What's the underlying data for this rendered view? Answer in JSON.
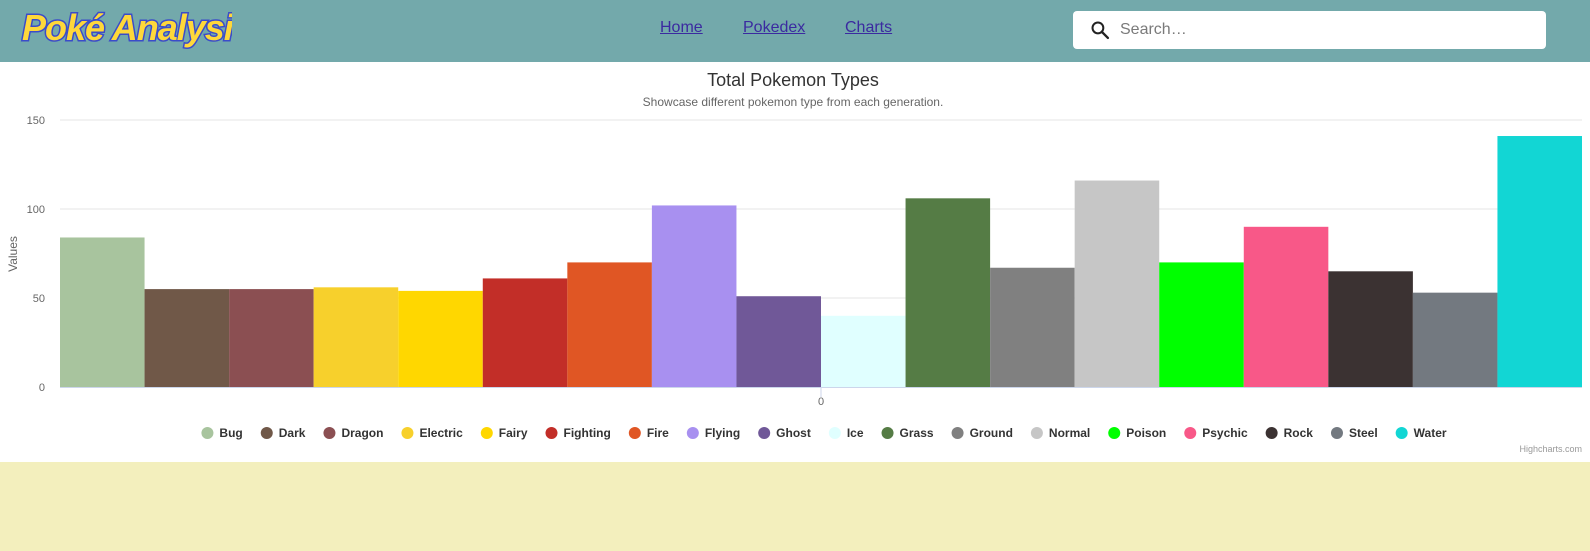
{
  "header": {
    "logo_text": "Poké Analysis",
    "nav": [
      {
        "label": "Home"
      },
      {
        "label": "Pokedex"
      },
      {
        "label": "Charts"
      }
    ],
    "search_placeholder": "Search…",
    "colors": {
      "bar": "#73a9ab",
      "logo_fill": "#ffd83a",
      "logo_stroke": "#3b4cca",
      "link": "#3b2aa0"
    },
    "icons": {
      "search": "search-icon"
    }
  },
  "chart_data": {
    "type": "bar",
    "title": "Total Pokemon Types",
    "subtitle": "Showcase different pokemon type from each generation.",
    "xlabel": "",
    "ylabel": "Values",
    "x_tick_labels": [
      "0"
    ],
    "y_ticks": [
      0,
      50,
      100,
      150
    ],
    "ylim": [
      0,
      150
    ],
    "grid": true,
    "legend_position": "bottom",
    "credits": "Highcharts.com",
    "series": [
      {
        "name": "Bug",
        "value": 84,
        "color": "#a8c49e"
      },
      {
        "name": "Dark",
        "value": 55,
        "color": "#705848"
      },
      {
        "name": "Dragon",
        "value": 55,
        "color": "#8b4f52"
      },
      {
        "name": "Electric",
        "value": 56,
        "color": "#f7d02c"
      },
      {
        "name": "Fairy",
        "value": 54,
        "color": "#ffd700"
      },
      {
        "name": "Fighting",
        "value": 61,
        "color": "#c22e28"
      },
      {
        "name": "Fire",
        "value": 70,
        "color": "#e05624"
      },
      {
        "name": "Flying",
        "value": 102,
        "color": "#a890f0"
      },
      {
        "name": "Ghost",
        "value": 51,
        "color": "#705898"
      },
      {
        "name": "Ice",
        "value": 40,
        "color": "#e0ffff"
      },
      {
        "name": "Grass",
        "value": 106,
        "color": "#557c45"
      },
      {
        "name": "Ground",
        "value": 67,
        "color": "#808080"
      },
      {
        "name": "Normal",
        "value": 116,
        "color": "#c6c6c6"
      },
      {
        "name": "Poison",
        "value": 70,
        "color": "#00ff00"
      },
      {
        "name": "Psychic",
        "value": 90,
        "color": "#f85888"
      },
      {
        "name": "Rock",
        "value": 65,
        "color": "#3b3232"
      },
      {
        "name": "Steel",
        "value": 53,
        "color": "#737980"
      },
      {
        "name": "Water",
        "value": 141,
        "color": "#12d6d4"
      }
    ]
  }
}
